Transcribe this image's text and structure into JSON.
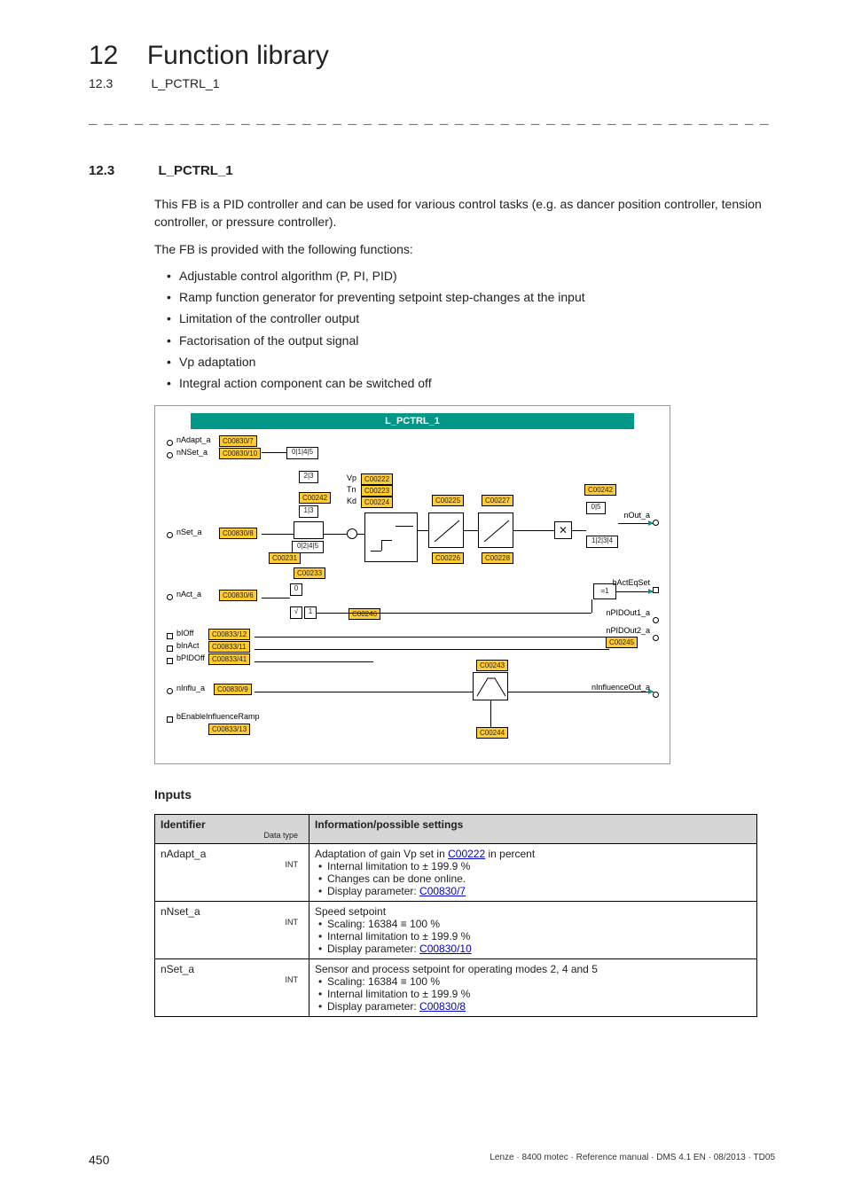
{
  "header": {
    "chapter_num": "12",
    "chapter_title": "Function library",
    "sub_num": "12.3",
    "sub_title": "L_PCTRL_1"
  },
  "dashes": "_ _ _ _ _ _ _ _ _ _ _ _ _ _ _ _ _ _ _ _ _ _ _ _ _ _ _ _ _ _ _ _ _ _ _ _ _ _ _ _ _ _ _ _ _ _ _ _ _ _ _ _ _ _ _ _ _ _ _ _ _ _ _ _",
  "section": {
    "num": "12.3",
    "title": "L_PCTRL_1",
    "intro1": "This FB is a PID controller and can be used for various control tasks (e.g. as dancer position controller, tension controller, or pressure controller).",
    "intro2": "The FB is provided with the following functions:",
    "bullets": [
      "Adjustable control algorithm (P, PI, PID)",
      "Ramp function generator for preventing setpoint step-changes at the input",
      "Limitation of the controller output",
      "Factorisation of the output signal",
      "Vp adaptation",
      "Integral action component can be switched off"
    ]
  },
  "diagram": {
    "title": "L_PCTRL_1",
    "left_signals": [
      "nAdapt_a",
      "nNSet_a",
      "nSet_a",
      "nAct_a",
      "bIOff",
      "bInAct",
      "bPIDOff",
      "nInflu_a",
      "bEnableInfluenceRamp"
    ],
    "right_signals": [
      "nOut_a",
      "bActEqSet",
      "nPIDOut1_a",
      "nPIDOut2_a",
      "nInfluenceOut_a"
    ],
    "chips": {
      "c7": "C00830/7",
      "c10": "C00830/10",
      "c8": "C00830/8",
      "c6": "C00830/6",
      "c12": "C00833/12",
      "c11": "C00833/11",
      "c41": "C00833/41",
      "c9": "C00830/9",
      "c13": "C00833/13",
      "c222": "C00222",
      "c223": "C00223",
      "c224": "C00224",
      "c242a": "C00242",
      "c242b": "C00242",
      "c231": "C00231",
      "c233": "C00233",
      "c246": "C00246",
      "c225": "C00225",
      "c227": "C00227",
      "c226": "C00226",
      "c228": "C00228",
      "c243": "C00243",
      "c244": "C00244",
      "c245": "C00245"
    },
    "mux": {
      "a": "0|1|4|5",
      "b": "2|3",
      "c": "1|3",
      "d": "0|2|4|5",
      "e": "0|5",
      "f": "1|2|3|4"
    },
    "misc": {
      "vp": "Vp",
      "tn": "Tn",
      "kd": "Kd",
      "x": "✕",
      "eq1": "=1",
      "zero": "0",
      "one": "1",
      "sqrt": "√"
    }
  },
  "inputs_heading": "Inputs",
  "table": {
    "h1": "Identifier",
    "h1_sub": "Data type",
    "h2": "Information/possible settings",
    "rows": [
      {
        "id": "nAdapt_a",
        "dt": "INT",
        "lead_a": "Adaptation of gain Vp set in ",
        "lead_link": "C00222",
        "lead_b": " in percent",
        "items": [
          "Internal limitation to ± 199.9 %",
          "Changes can be done online."
        ],
        "disp_a": "Display parameter: ",
        "disp_link": "C00830/7"
      },
      {
        "id": "nNset_a",
        "dt": "INT",
        "lead_a": "Speed setpoint",
        "lead_link": "",
        "lead_b": "",
        "items": [
          "Scaling: 16384 ≡ 100 %",
          "Internal limitation to ± 199.9 %"
        ],
        "disp_a": "Display parameter: ",
        "disp_link": "C00830/10"
      },
      {
        "id": "nSet_a",
        "dt": "INT",
        "lead_a": "Sensor and process setpoint for operating modes 2, 4 and 5",
        "lead_link": "",
        "lead_b": "",
        "items": [
          "Scaling: 16384 ≡ 100 %",
          "Internal limitation to ± 199.9 %"
        ],
        "disp_a": "Display parameter: ",
        "disp_link": "C00830/8"
      }
    ]
  },
  "footer": {
    "page": "450",
    "meta": "Lenze · 8400 motec · Reference manual · DMS 4.1 EN · 08/2013 · TD05"
  }
}
